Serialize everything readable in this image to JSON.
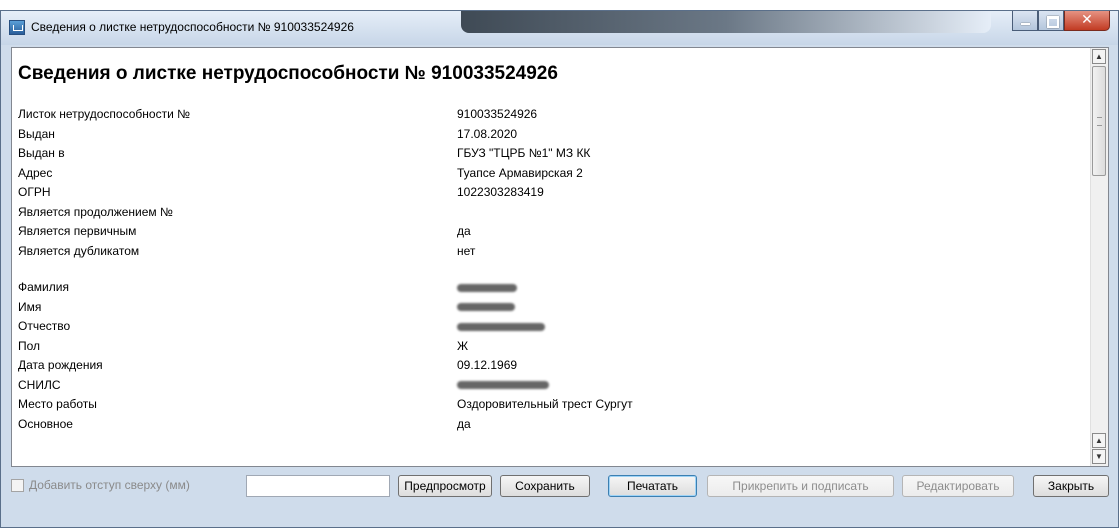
{
  "window": {
    "title": "Сведения о листке нетрудоспособности № 910033524926"
  },
  "heading": "Сведения о листке нетрудоспособности № 910033524926",
  "fields": [
    {
      "label": "Листок нетрудоспособности №",
      "value": "910033524926"
    },
    {
      "label": "Выдан",
      "value": "17.08.2020"
    },
    {
      "label": "Выдан в",
      "value": "ГБУЗ \"ТЦРБ №1\" МЗ КК"
    },
    {
      "label": "Адрес",
      "value": "Туапсе Армавирская 2"
    },
    {
      "label": "ОГРН",
      "value": "1022303283419"
    },
    {
      "label": "Является продолжением №",
      "value": ""
    },
    {
      "label": "Является первичным",
      "value": "да"
    },
    {
      "label": "Является дубликатом",
      "value": "нет"
    }
  ],
  "person_fields": [
    {
      "label": "Фамилия",
      "value": ""
    },
    {
      "label": "Имя",
      "value": ""
    },
    {
      "label": "Отчество",
      "value": ""
    },
    {
      "label": "Пол",
      "value": "Ж"
    },
    {
      "label": "Дата рождения",
      "value": "09.12.1969"
    },
    {
      "label": "СНИЛС",
      "value": ""
    },
    {
      "label": "Место работы",
      "value": "Оздоровительный трест Сургут"
    },
    {
      "label": "Основное",
      "value": "да"
    }
  ],
  "footer": {
    "checkbox_label": "Добавить отступ сверху (мм)",
    "margin_value": "",
    "preview": "Предпросмотр",
    "save": "Сохранить",
    "print": "Печатать",
    "attach_sign": "Прикрепить и подписать",
    "edit": "Редактировать",
    "close": "Закрыть"
  }
}
